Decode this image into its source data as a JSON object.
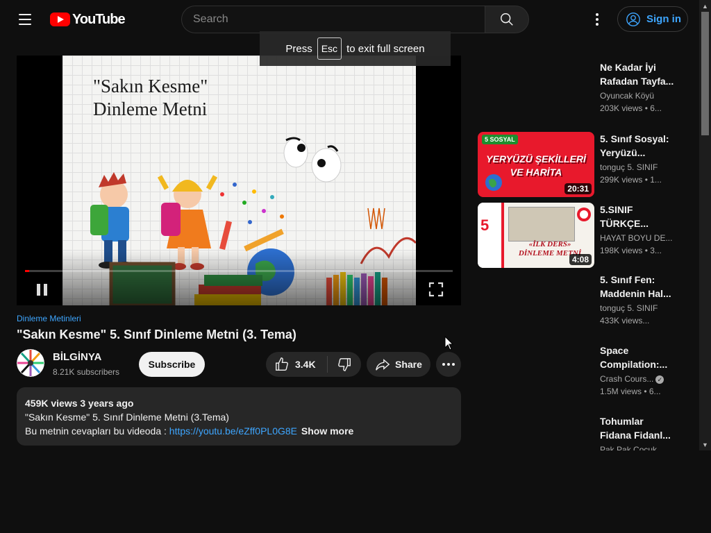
{
  "header": {
    "logo_text": "YouTube",
    "search_placeholder": "Search",
    "sign_in_label": "Sign in"
  },
  "fullscreen_toast": {
    "press": "Press",
    "key": "Esc",
    "suffix": "to exit full screen"
  },
  "player": {
    "frame_title_line1": "\"Sakın Kesme\"",
    "frame_title_line2": "Dinleme Metni",
    "progress_fraction": 0.01,
    "state": "playing"
  },
  "video": {
    "tag": "Dinleme Metinleri",
    "title": "\"Sakın Kesme\" 5. Sınıf Dinleme Metni (3. Tema)"
  },
  "channel": {
    "name": "BİLGİNYA",
    "subscribers": "8.21K subscribers",
    "subscribe_label": "Subscribe"
  },
  "actions": {
    "like_count": "3.4K",
    "share_label": "Share"
  },
  "description": {
    "meta": "459K views  3 years ago",
    "line1": "\"Sakın Kesme\" 5. Sınıf Dinleme Metni (3.Tema)",
    "line2_prefix": "Bu metnin cevapları bu videoda : ",
    "link": "https://youtu.be/eZff0PL0G8E",
    "show_more": "Show more"
  },
  "recommendations": [
    {
      "title_l1": "Ne Kadar İyi",
      "title_l2": "Rafadan Tayfa...",
      "channel": "Oyuncak Köyü",
      "views": "203K views  • 6...",
      "duration": "",
      "thumb": "none"
    },
    {
      "title_l1": "5. Sınıf Sosyal:",
      "title_l2": "Yeryüzü...",
      "channel": "tonguç 5. SINIF",
      "views": "299K views  • 1...",
      "duration": "20:31",
      "thumb": "yeryuzu",
      "thumb_text_l1": "YERYÜZÜ ŞEKİLLERİ",
      "thumb_text_l2": "VE HARİTA",
      "thumb_badge": "5 SOSYAL"
    },
    {
      "title_l1": "5.SINIF",
      "title_l2": "TÜRKÇE...",
      "channel": "HAYAT BOYU DE...",
      "views": "198K views  • 3...",
      "duration": "4:08",
      "thumb": "turkce",
      "thumb_side": "5. SINIF",
      "thumb_text_l1": "«İLK DERS»",
      "thumb_text_l2": "DİNLEME METNİ"
    },
    {
      "title_l1": "5. Sınıf Fen:",
      "title_l2": "Maddenin Hal...",
      "channel": "tonguç 5. SINIF",
      "views": "433K views...",
      "duration": "",
      "thumb": "none"
    },
    {
      "title_l1": "Space",
      "title_l2": "Compilation:...",
      "channel": "Crash Cours...",
      "views": "1.5M views  • 6...",
      "duration": "",
      "thumb": "none",
      "verified": true
    },
    {
      "title_l1": "Tohumlar",
      "title_l2": "Fidana Fidanl...",
      "channel": "Pak Pak Çocuk",
      "views": "",
      "duration": "",
      "thumb": "none"
    }
  ],
  "colors": {
    "background": "#0f0f0f",
    "accent_link": "#3ea6ff",
    "brand_red": "#ff0000",
    "chip": "#272727"
  },
  "icons": {
    "menu": "hamburger-icon",
    "search": "search-icon",
    "more": "more-vert-icon",
    "account": "account-circle-icon",
    "pause": "pause-icon",
    "fullscreen": "fullscreen-icon",
    "like": "thumbs-up-icon",
    "dislike": "thumbs-down-icon",
    "share": "share-icon"
  }
}
